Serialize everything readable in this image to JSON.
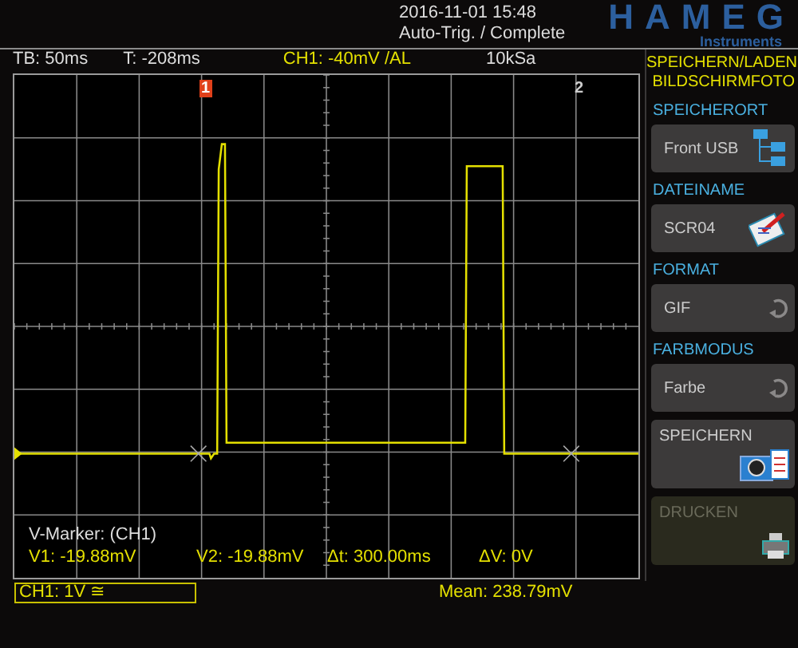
{
  "header": {
    "datetime": "2016-11-01 15:48",
    "status": "Auto-Trig. / Complete",
    "logo": "HAMEG",
    "logo_sub": "Instruments"
  },
  "info_bar": {
    "timebase": "TB: 50ms",
    "trigger_time": "T: -208ms",
    "trigger": "CH1: -40mV /AL",
    "sample_rate": "10kSa"
  },
  "cursors": [
    {
      "label": "1",
      "selected": true
    },
    {
      "label": "2",
      "selected": false
    }
  ],
  "readout": {
    "title": "V-Marker: (CH1)",
    "values": [
      "V1: -19.88mV",
      "V2: -19.88mV",
      "Δt: 300.00ms",
      "ΔV: 0V"
    ]
  },
  "channel": "CH1: 1V ≅",
  "mean": "Mean: 238.79mV",
  "menu": {
    "title": [
      "SPEICHERN/LADEN",
      "BILDSCHIRMFOTO"
    ],
    "items": [
      {
        "heading": "SPEICHERORT",
        "label": "Front USB",
        "kind": "folders",
        "disabled": false
      },
      {
        "heading": "DATEINAME",
        "label": "SCR04",
        "kind": "notepad",
        "disabled": false
      },
      {
        "heading": "FORMAT",
        "label": "GIF",
        "kind": "cycle",
        "disabled": false
      },
      {
        "heading": "FARBMODUS",
        "label": "Farbe",
        "kind": "cycle",
        "disabled": false
      },
      {
        "label": "SPEICHERN",
        "kind": "camera",
        "disabled": false
      },
      {
        "label": "DRUCKEN",
        "kind": "printer",
        "disabled": true
      }
    ]
  }
}
